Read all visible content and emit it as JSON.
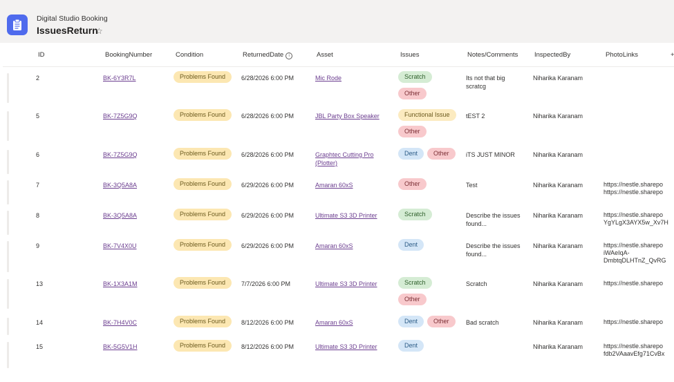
{
  "app": {
    "subtitle": "Digital Studio Booking",
    "title": "IssuesReturn",
    "star": "☆",
    "accent": "#4f6bed"
  },
  "columns": [
    "ID",
    "BookingNumber",
    "Condition",
    "ReturnedDate",
    "Asset",
    "Issues",
    "Notes/Comments",
    "InspectedBy",
    "PhotoLinks"
  ],
  "header_extra": "+",
  "rows": [
    {
      "id": "2",
      "booking": "BK-6Y3R7L",
      "condition": "Problems Found",
      "date": "6/28/2026 6:00 PM",
      "asset": [
        "Mic Rode"
      ],
      "issues": [
        "Scratch",
        "Other"
      ],
      "notes": [
        "Its not that big",
        "scratcg"
      ],
      "inspected": "Niharika Karanam",
      "photos": []
    },
    {
      "id": "5",
      "booking": "BK-7Z5G9Q",
      "condition": "Problems Found",
      "date": "6/28/2026 6:00 PM",
      "asset": [
        "JBL Party Box Speaker"
      ],
      "issues": [
        "Functional Issue",
        "Other"
      ],
      "notes": [
        "tEST 2"
      ],
      "inspected": "Niharika Karanam",
      "photos": []
    },
    {
      "id": "6",
      "booking": "BK-7Z5G9Q",
      "condition": "Problems Found",
      "date": "6/28/2026 6:00 PM",
      "asset": [
        "Graphtec Cutting Pro",
        "(Plotter)"
      ],
      "issues": [
        "Dent",
        "Other"
      ],
      "notes": [
        "iTS JUST MINOR"
      ],
      "inspected": "Niharika Karanam",
      "photos": []
    },
    {
      "id": "7",
      "booking": "BK-3Q5A8A",
      "condition": "Problems Found",
      "date": "6/29/2026 6:00 PM",
      "asset": [
        "Amaran 60xS"
      ],
      "issues": [
        "Other"
      ],
      "notes": [
        "Test"
      ],
      "inspected": "Niharika Karanam",
      "photos": [
        "https://nestle.sharepo",
        "https://nestle.sharepo"
      ]
    },
    {
      "id": "8",
      "booking": "BK-3Q5A8A",
      "condition": "Problems Found",
      "date": "6/29/2026 6:00 PM",
      "asset": [
        "Ultimate S3 3D Printer"
      ],
      "issues": [
        "Scratch"
      ],
      "notes": [
        "Describe the issues",
        "found..."
      ],
      "inspected": "Niharika Karanam",
      "photos": [
        "https://nestle.sharepo",
        "YgYLgX3AYX5w_Xv7H"
      ]
    },
    {
      "id": "9",
      "booking": "BK-7V4X0U",
      "condition": "Problems Found",
      "date": "6/29/2026 6:00 PM",
      "asset": [
        "Amaran 60xS"
      ],
      "issues": [
        "Dent"
      ],
      "notes": [
        "Describe the issues",
        "found..."
      ],
      "inspected": "Niharika Karanam",
      "photos": [
        "https://nestle.sharepo",
        "iWAeIqA-",
        "DmbtqDLHTnZ_QvRG"
      ]
    },
    {
      "id": "13",
      "booking": "BK-1X3A1M",
      "condition": "Problems Found",
      "date": "7/7/2026 6:00 PM",
      "asset": [
        "Ultimate S3 3D Printer"
      ],
      "issues": [
        "Scratch",
        "Other"
      ],
      "notes": [
        "Scratch"
      ],
      "inspected": "Niharika Karanam",
      "photos": [
        "https://nestle.sharepo"
      ]
    },
    {
      "id": "14",
      "booking": "BK-7H4V0C",
      "condition": "Problems Found",
      "date": "8/12/2026 6:00 PM",
      "asset": [
        "Amaran 60xS"
      ],
      "issues": [
        "Dent",
        "Other"
      ],
      "notes": [
        "Bad scratch"
      ],
      "inspected": "Niharika Karanam",
      "photos": [
        "https://nestle.sharepo"
      ]
    },
    {
      "id": "15",
      "booking": "BK-5G5V1H",
      "condition": "Problems Found",
      "date": "8/12/2026 6:00 PM",
      "asset": [
        "Ultimate S3 3D Printer"
      ],
      "issues": [
        "Dent"
      ],
      "notes": [],
      "inspected": "Niharika Karanam",
      "photos": [
        "https://nestle.sharepo",
        "fdb2VAaavEfg71CvBx"
      ]
    }
  ]
}
